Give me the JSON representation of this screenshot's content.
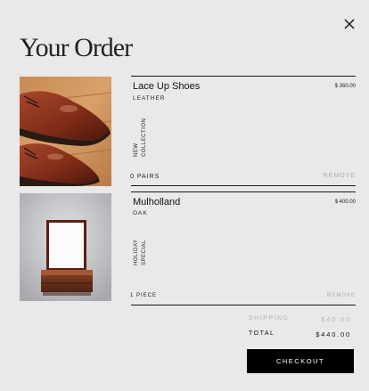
{
  "header": {
    "title": "Your Order",
    "close_icon": "close-icon"
  },
  "items": [
    {
      "name": "Lace Up Shoes",
      "material": "LEATHER",
      "price": "$ 360.00",
      "tag_line1": "NEW",
      "tag_line2": "COLLECTION",
      "quantity": "0 PAIRS",
      "remove_label": "REMOVE",
      "image": "brown-leather-shoes-photo"
    },
    {
      "name": "Mulholland",
      "material": "OAK",
      "price": "$ 400.00",
      "tag_line1": "HOLIDAY",
      "tag_line2": "SPECIAL",
      "quantity": "1 PIECE",
      "remove_label": "REMOVE",
      "image": "wooden-mirror-box-photo"
    }
  ],
  "summary": {
    "shipping_label": "SHIPPING",
    "shipping_value": "$40.00",
    "total_label": "TOTAL",
    "total_value": "$440.00"
  },
  "actions": {
    "checkout_label": "CHECKOUT"
  },
  "colors": {
    "background": "#e9e9e9",
    "button": "#000000",
    "muted_text": "#b3b3b3"
  }
}
